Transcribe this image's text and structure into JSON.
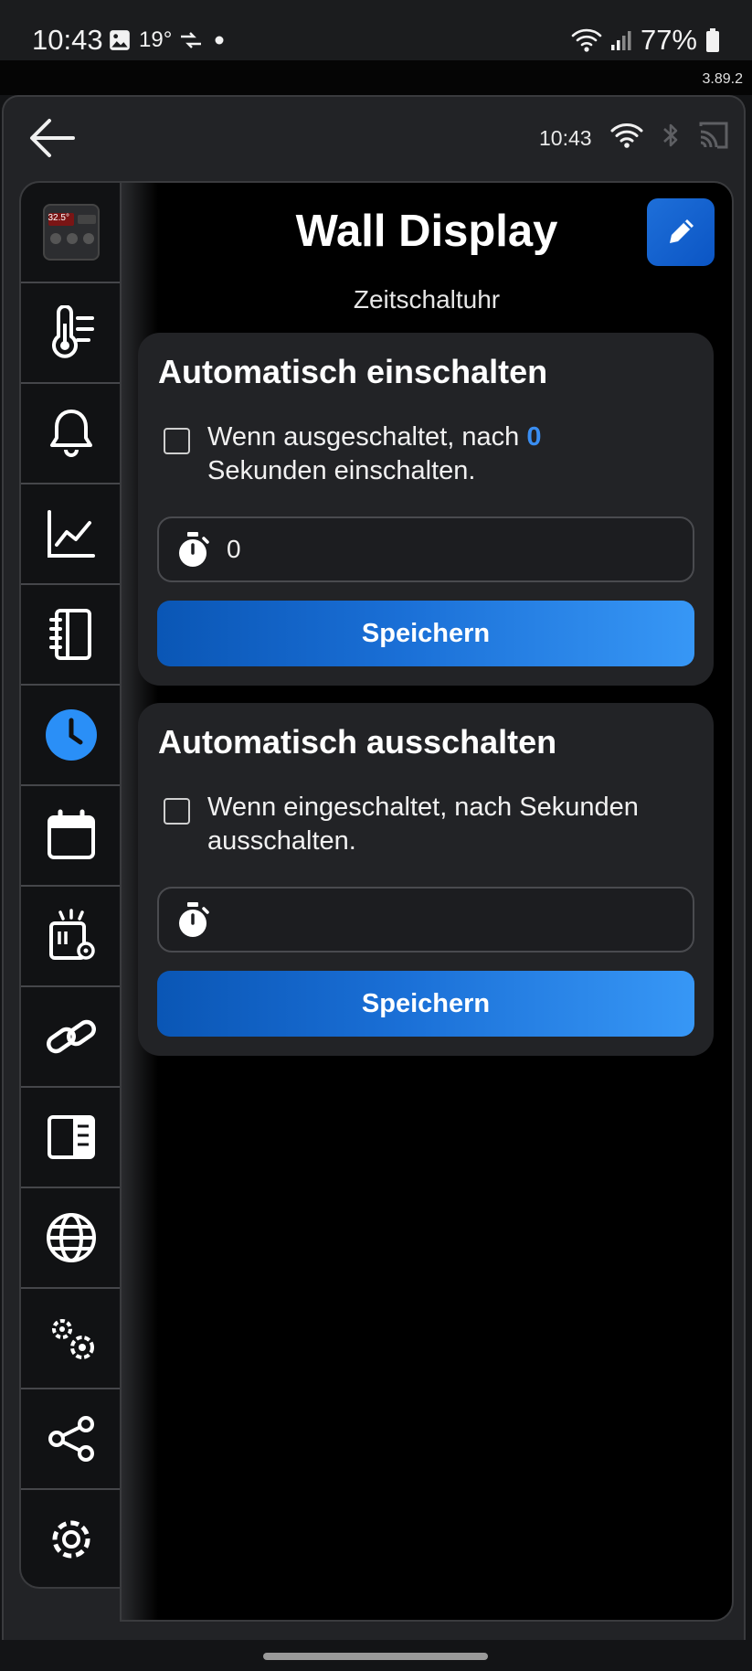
{
  "status_bar": {
    "time": "10:43",
    "temperature": "19°",
    "battery": "77%",
    "icons": [
      "image-icon",
      "swap-icon",
      "dot-icon",
      "wifi-icon",
      "signal-icon",
      "battery-icon"
    ]
  },
  "app_version": "3.89.2",
  "header": {
    "time": "10:43",
    "icons": [
      "back-arrow-icon",
      "wifi-icon",
      "bluetooth-icon",
      "cast-icon"
    ]
  },
  "sidebar": {
    "items": [
      {
        "name": "device-thumbnail",
        "icon": "device-thumbnail",
        "thumb_text": "32.5°"
      },
      {
        "name": "sensors",
        "icon": "thermometer-list-icon"
      },
      {
        "name": "alarms",
        "icon": "bell-icon"
      },
      {
        "name": "charts",
        "icon": "chart-line-icon"
      },
      {
        "name": "notebook",
        "icon": "notebook-icon"
      },
      {
        "name": "timer",
        "icon": "clock-icon",
        "active": true
      },
      {
        "name": "calendar",
        "icon": "calendar-icon"
      },
      {
        "name": "actions",
        "icon": "alert-settings-icon"
      },
      {
        "name": "links",
        "icon": "link-icon"
      },
      {
        "name": "display",
        "icon": "panel-icon"
      },
      {
        "name": "web",
        "icon": "globe-icon"
      },
      {
        "name": "advanced",
        "icon": "gears-icon"
      },
      {
        "name": "share",
        "icon": "share-icon"
      },
      {
        "name": "settings",
        "icon": "gear-icon"
      }
    ]
  },
  "page": {
    "title": "Wall Display",
    "subtitle": "Zeitschaltuhr"
  },
  "auto_on": {
    "title": "Automatisch einschalten",
    "text_before": "Wenn ausgeschaltet, nach",
    "seconds": "0",
    "text_after": "Sekunden einschalten.",
    "input_value": "0",
    "save_label": "Speichern",
    "checked": false
  },
  "auto_off": {
    "title": "Automatisch ausschalten",
    "text": "Wenn eingeschaltet, nach Sekunden ausschalten.",
    "input_value": "",
    "save_label": "Speichern",
    "checked": false
  },
  "colors": {
    "accent": "#1e6fd9",
    "highlight": "#3a8ef2",
    "card": "#222326",
    "background": "#000000"
  }
}
